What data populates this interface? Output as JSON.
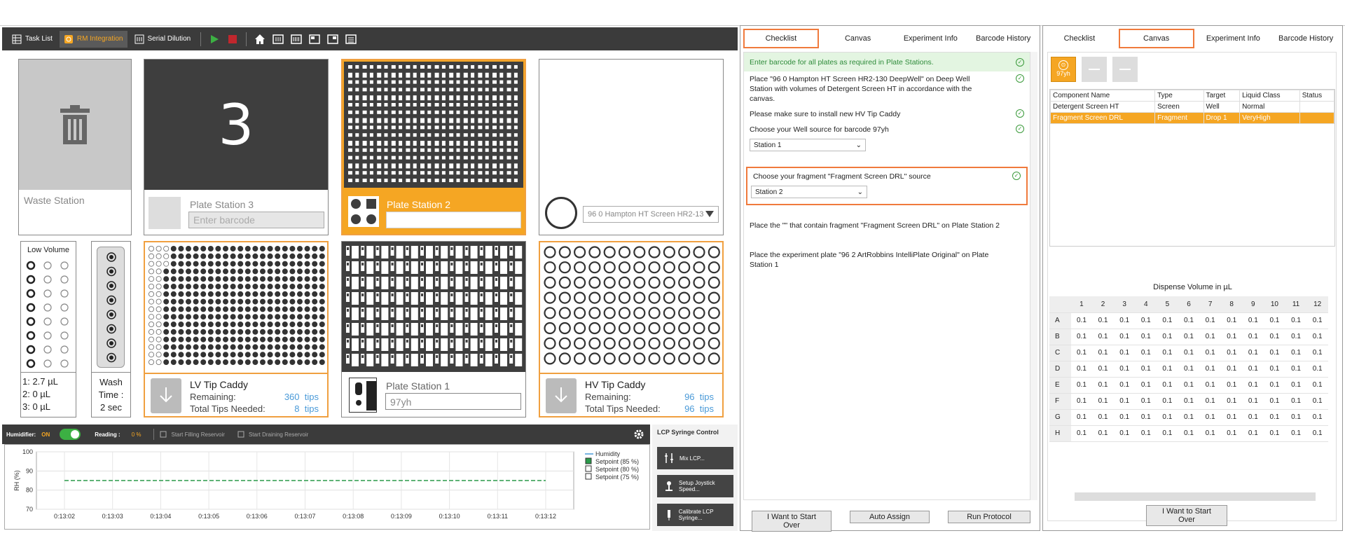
{
  "toolbar": {
    "task_list": "Task List",
    "rm_integration": "RM Integration",
    "serial_dilution": "Serial Dilution"
  },
  "waste": {
    "label": "Waste Station"
  },
  "ps3": {
    "number": "3",
    "label": "Plate Station 3",
    "placeholder": "Enter barcode"
  },
  "ps2": {
    "label": "Plate Station 2",
    "value": ""
  },
  "ps4": {
    "select": "96 0 Hampton HT Screen HR2-13"
  },
  "low_volume": {
    "title": "Low Volume",
    "lines": [
      "1: 2.7 µL",
      "2: 0 µL",
      "3: 0 µL"
    ]
  },
  "wash": {
    "line1": "Wash",
    "line2": "Time :",
    "line3": "2 sec"
  },
  "lv": {
    "title": "LV Tip Caddy",
    "remaining_label": "Remaining:",
    "remaining": "360",
    "tips_unit": "tips",
    "needed_label": "Total Tips Needed:",
    "needed": "8"
  },
  "ps1": {
    "label": "Plate Station 1",
    "value": "97yh"
  },
  "hv": {
    "title": "HV Tip Caddy",
    "remaining_label": "Remaining:",
    "remaining": "96",
    "tips_unit": "tips",
    "needed_label": "Total Tips Needed:",
    "needed": "96"
  },
  "humidifier": {
    "label": "Humidifier:",
    "state": "ON",
    "reading_label": "Reading :",
    "reading": "0 %",
    "start_fill": "Start Filling Reservoir",
    "start_drain": "Start Draining Reservoir"
  },
  "chart_data": {
    "type": "line",
    "ylabel": "RH (%)",
    "ylim": [
      70,
      100
    ],
    "yticks": [
      "100",
      "90",
      "80",
      "70"
    ],
    "x": [
      "0:13:02",
      "0:13:03",
      "0:13:04",
      "0:13:05",
      "0:13:06",
      "0:13:07",
      "0:13:08",
      "0:13:09",
      "0:13:10",
      "0:13:11",
      "0:13:12"
    ],
    "series": [
      {
        "name": "Setpoint (85 %)",
        "values": [
          85,
          85,
          85,
          85,
          85,
          85,
          85,
          85,
          85,
          85,
          85
        ],
        "color": "#2a9a4a"
      }
    ],
    "legend": [
      "Humidity",
      "Setpoint (85 %)",
      "Setpoint (80 %)",
      "Setpoint (75 %)"
    ]
  },
  "lcp": {
    "title": "LCP Syringe Control",
    "mix": "Mix LCP...",
    "joystick": "Setup Joystick Speed...",
    "calibrate": "Calibrate LCP Syringe..."
  },
  "checklist": {
    "tabs": [
      "Checklist",
      "Canvas",
      "Experiment Info",
      "Barcode History"
    ],
    "item1": "Enter barcode for all plates as required in Plate Stations.",
    "item2": "Place \"96 0 Hampton HT Screen HR2-130 DeepWell\" on Deep Well Station with volumes of Detergent Screen HT in accordance with the canvas.",
    "item3": "Please make sure to install new HV Tip Caddy",
    "item4": "Choose your Well source for barcode 97yh",
    "select1": "Station 1",
    "item5": "Choose your fragment \"Fragment Screen DRL\" source",
    "select2": "Station 2",
    "item6": "Place the \"\" that contain fragment \"Fragment Screen DRL\" on Plate Station 2",
    "item7": "Place the experiment plate  \"96 2 ArtRobbins IntelliPlate Original\" on Plate Station 1",
    "start_over": "I Want to Start Over",
    "auto_assign": "Auto Assign",
    "run": "Run Protocol"
  },
  "canvas": {
    "tabs": [
      "Checklist",
      "Canvas",
      "Experiment Info",
      "Barcode History"
    ],
    "plate_btn": "97yh",
    "headers": [
      "Component Name",
      "Type",
      "Target",
      "Liquid Class",
      "Status"
    ],
    "rows": [
      [
        "Detergent Screen HT",
        "Screen",
        "Well",
        "Normal",
        ""
      ],
      [
        "Fragment Screen DRL",
        "Fragment",
        "Drop 1",
        "VeryHigh",
        ""
      ]
    ],
    "dispense_title": "Dispense Volume in µL",
    "cols": [
      "1",
      "2",
      "3",
      "4",
      "5",
      "6",
      "7",
      "8",
      "9",
      "10",
      "11",
      "12"
    ],
    "row_labels": [
      "A",
      "B",
      "C",
      "D",
      "E",
      "F",
      "G",
      "H"
    ],
    "cell": "0.1",
    "start_over": "I Want to Start Over"
  }
}
